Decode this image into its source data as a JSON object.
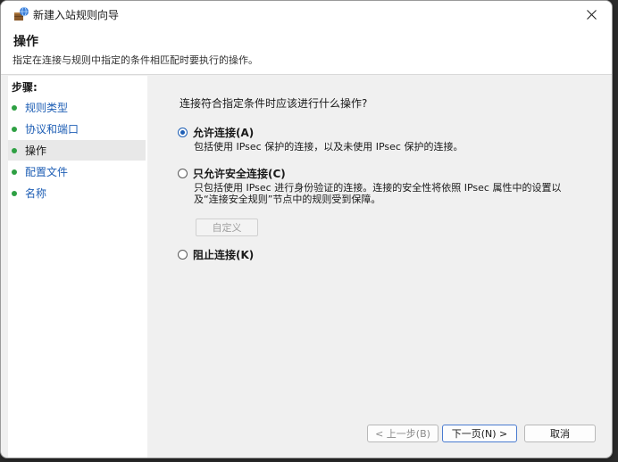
{
  "window": {
    "title": "新建入站规则向导"
  },
  "header": {
    "title": "操作",
    "description": "指定在连接与规则中指定的条件相匹配时要执行的操作。"
  },
  "steps": {
    "title": "步骤:",
    "items": [
      {
        "label": "规则类型"
      },
      {
        "label": "协议和端口"
      },
      {
        "label": "操作"
      },
      {
        "label": "配置文件"
      },
      {
        "label": "名称"
      }
    ]
  },
  "main": {
    "question": "连接符合指定条件时应该进行什么操作?",
    "options": [
      {
        "label": "允许连接(A)",
        "desc": "包括使用 IPsec 保护的连接，以及未使用 IPsec 保护的连接。",
        "selected": true
      },
      {
        "label": "只允许安全连接(C)",
        "desc": "只包括使用 IPsec 进行身份验证的连接。连接的安全性将依照 IPsec 属性中的设置以及“连接安全规则”节点中的规则受到保障。",
        "selected": false
      },
      {
        "label": "阻止连接(K)",
        "desc": "",
        "selected": false
      }
    ],
    "customize_label": "自定义"
  },
  "footer": {
    "back_label": "< 上一步(B)",
    "next_label": "下一页(N) >",
    "cancel_label": "取消"
  },
  "colors": {
    "accent": "#1f5fb5",
    "step_dot": "#2ea043"
  }
}
